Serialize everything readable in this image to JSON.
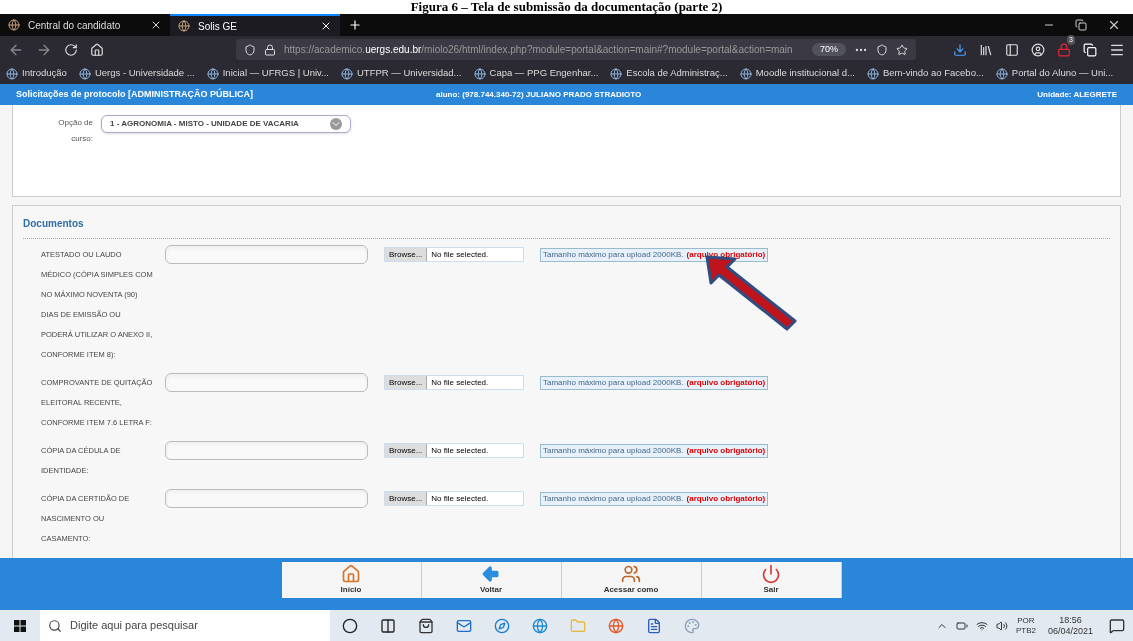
{
  "caption": "Figura 6 – Tela de submissão da documentação (parte 2)",
  "browser": {
    "tabs": [
      {
        "title": "Central do candidato",
        "selected": false
      },
      {
        "title": "Solis GE",
        "selected": true
      }
    ],
    "url": {
      "prefix": "https://academico.",
      "host": "uergs.edu.br",
      "path": "/miolo26/html/index.php?module=portal&action=main#?module=portal&action=main"
    },
    "zoom": "70%",
    "badge": "3",
    "bookmarks": [
      "Introdução",
      "Uergs - Universidade ...",
      "Inicial — UFRGS | Univ...",
      "UTFPR — Universidad...",
      "Capa — PPG Engenhar...",
      "Escola de Administraç...",
      "Moodle institucional d...",
      "Bem-vindo ao Facebo...",
      "Portal do Aluno — Uni..."
    ]
  },
  "app": {
    "title": "Solicitações de protocolo [ADMINISTRAÇÃO PÚBLICA]",
    "user": "aluno: (978.744.340-72) JULIANO PRADO STRADIOTO",
    "unit": "Unidade: ALEGRETE",
    "course": {
      "label": "Opção de curso:",
      "value": "1 - AGRONOMIA - MISTO - UNIDADE DE VACARIA"
    },
    "section": "Documentos",
    "documents": [
      {
        "label": "ATESTADO OU LAUDO MÉDICO (CÓPIA SIMPLES COM NO MÁXIMO NOVENTA (90) DIAS DE EMISSÃO OU PODERÁ UTILIZAR O ANEXO II, CONFORME ITEM 8):",
        "button": "Browse...",
        "file": "No file selected.",
        "hint": "Tamanho máximo para upload 2000KB.",
        "required": "(arquivo obrigatório)"
      },
      {
        "label": "COMPROVANTE DE QUITAÇÃO ELEITORAL RECENTE, CONFORME ITEM 7.6 LETRA F:",
        "button": "Browse...",
        "file": "No file selected.",
        "hint": "Tamanho máximo para upload 2000KB.",
        "required": "(arquivo obrigatório)"
      },
      {
        "label": "CÓPIA DA CÉDULA DE IDENTIDADE:",
        "button": "Browse...",
        "file": "No file selected.",
        "hint": "Tamanho máximo para upload 2000KB.",
        "required": "(arquivo obrigatório)"
      },
      {
        "label": "CÓPIA DA CERTIDÃO DE NASCIMENTO OU CASAMENTO:",
        "button": "Browse...",
        "file": "No file selected.",
        "hint": "Tamanho máximo para upload 2000KB.",
        "required": "(arquivo obrigatório)"
      }
    ],
    "nav": [
      {
        "label": "Início",
        "kind": "home"
      },
      {
        "label": "Voltar",
        "kind": "back"
      },
      {
        "label": "Acessar como",
        "kind": "users"
      },
      {
        "label": "Sair",
        "kind": "exit"
      }
    ]
  },
  "taskbar": {
    "search_placeholder": "Digite aqui para pesquisar",
    "language": "POR",
    "layout": "PTB2",
    "time": "18:56",
    "date": "06/04/2021"
  }
}
